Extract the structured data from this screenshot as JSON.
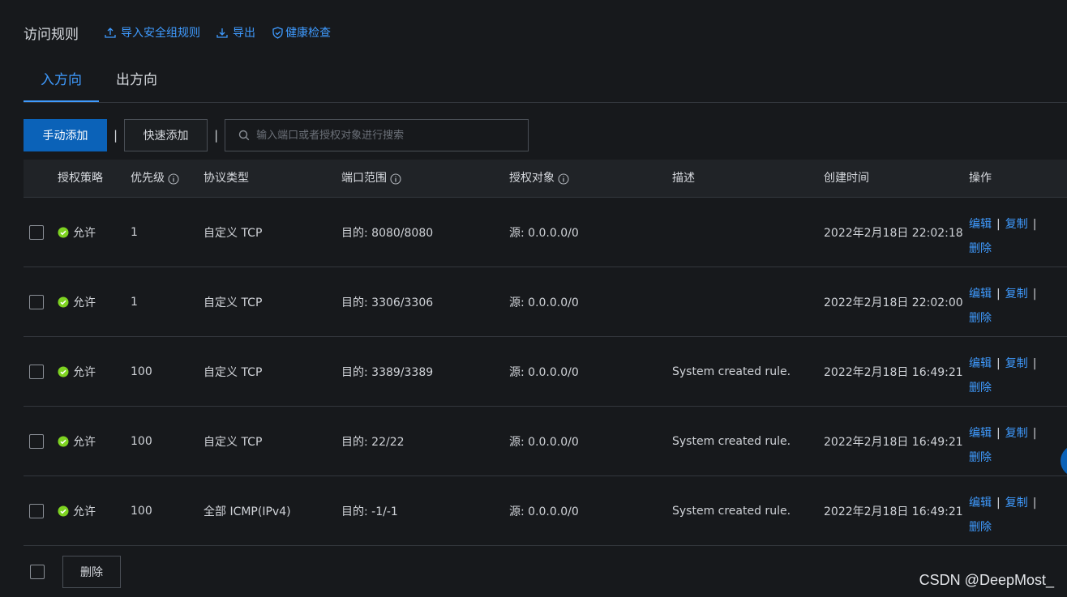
{
  "header": {
    "title": "访问规则",
    "import_label": "导入安全组规则",
    "export_label": "导出",
    "health_label": "健康检查"
  },
  "tabs": [
    {
      "label": "入方向",
      "active": true
    },
    {
      "label": "出方向",
      "active": false
    }
  ],
  "toolbar": {
    "manual_add": "手动添加",
    "separator": "|",
    "quick_add": "快速添加",
    "search_placeholder": "输入端口或者授权对象进行搜索"
  },
  "table": {
    "columns": [
      "授权策略",
      "优先级",
      "协议类型",
      "端口范围",
      "授权对象",
      "描述",
      "创建时间",
      "操作"
    ],
    "rows": [
      {
        "action": "允许",
        "priority": "1",
        "protocol": "自定义 TCP",
        "port": "目的: 8080/8080",
        "object": "源: 0.0.0.0/0",
        "desc": "",
        "time": "2022年2月18日 22:02:18"
      },
      {
        "action": "允许",
        "priority": "1",
        "protocol": "自定义 TCP",
        "port": "目的: 3306/3306",
        "object": "源: 0.0.0.0/0",
        "desc": "",
        "time": "2022年2月18日 22:02:00"
      },
      {
        "action": "允许",
        "priority": "100",
        "protocol": "自定义 TCP",
        "port": "目的: 3389/3389",
        "object": "源: 0.0.0.0/0",
        "desc": "System created rule.",
        "time": "2022年2月18日 16:49:21"
      },
      {
        "action": "允许",
        "priority": "100",
        "protocol": "自定义 TCP",
        "port": "目的: 22/22",
        "object": "源: 0.0.0.0/0",
        "desc": "System created rule.",
        "time": "2022年2月18日 16:49:21"
      },
      {
        "action": "允许",
        "priority": "100",
        "protocol": "全部 ICMP(IPv4)",
        "port": "目的: -1/-1",
        "object": "源: 0.0.0.0/0",
        "desc": "System created rule.",
        "time": "2022年2月18日 16:49:21"
      }
    ],
    "ops": {
      "edit": "编辑",
      "copy": "复制",
      "delete": "删除",
      "sep": "|"
    }
  },
  "footer": {
    "delete_label": "删除"
  },
  "watermark": "CSDN @DeepMost_",
  "colors": {
    "accent": "#3f9bff",
    "primary_button": "#0b62b8",
    "allow_icon": "#7ed321",
    "background": "#17191c"
  }
}
